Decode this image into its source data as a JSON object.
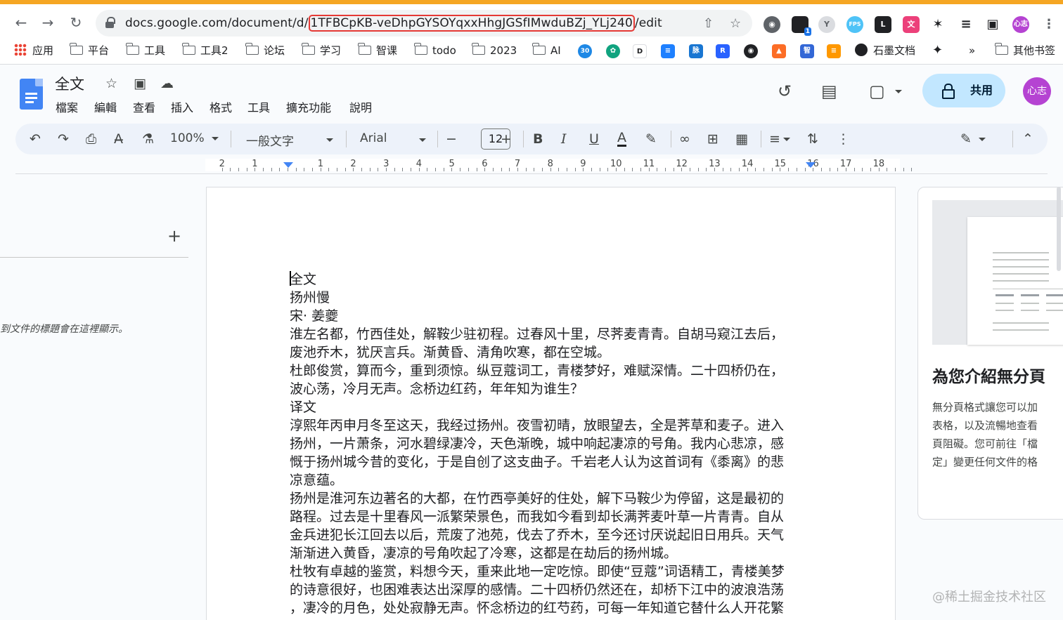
{
  "browser": {
    "url_prefix": "docs.google.com/document/d/",
    "url_id": "1TFBCpKB-veDhpGYSOYqxxHhgJGSfIMwduBZj_YLj240",
    "url_suffix": "/edit",
    "profile_avatar": "心志",
    "extension_badge": "1"
  },
  "bookmarks": {
    "apps": "应用",
    "folders": [
      "平台",
      "工具",
      "工具2",
      "论坛",
      "学习",
      "智课",
      "todo",
      "2023",
      "AI"
    ],
    "badge_30": "30",
    "shimo": "石墨文档",
    "more": "»",
    "other": "其他书签"
  },
  "docs": {
    "title": "全文",
    "menu": [
      "檔案",
      "編輯",
      "查看",
      "插入",
      "格式",
      "工具",
      "擴充功能",
      "說明"
    ],
    "share_label": "共用",
    "avatar": "心志"
  },
  "toolbar": {
    "zoom": "100%",
    "style": "一般文字",
    "font": "Arial",
    "font_size": "12",
    "minus": "−",
    "plus": "+",
    "bold": "B",
    "italic": "I",
    "underline": "U",
    "text_color": "A"
  },
  "ruler": {
    "labels": [
      "2",
      "1",
      "1",
      "2",
      "3",
      "4",
      "5",
      "6",
      "7",
      "8",
      "9",
      "10",
      "11",
      "12",
      "13",
      "14",
      "15",
      "16",
      "17",
      "18"
    ]
  },
  "outline": {
    "hint": "到文件的標題會在這裡顯示。",
    "add": "+"
  },
  "document": {
    "lines": [
      "全文",
      "扬州慢",
      "宋· 姜夔",
      "淮左名都，竹西佳处，解鞍少驻初程。过春风十里，尽荠麦青青。自胡马窥江去后，",
      "废池乔木，犹厌言兵。渐黄昏、清角吹寒，都在空城。",
      "杜郎俊赏，算而今，重到须惊。纵豆蔻词工，青楼梦好，难赋深情。二十四桥仍在，",
      "波心荡，冷月无声。念桥边红药，年年知为谁生？",
      "译文",
      "淳熙年丙申月冬至这天，我经过扬州。夜雪初晴，放眼望去，全是荠草和麦子。进入",
      "扬州，一片萧条，河水碧绿凄冷，天色渐晚，城中响起凄凉的号角。我内心悲凉，感",
      "慨于扬州城今昔的变化，于是自创了这支曲子。千岩老人认为这首词有《黍离》的悲",
      "凉意蕴。",
      "扬州是淮河东边著名的大都，在竹西亭美好的住处，解下马鞍少为停留，这是最初的",
      "路程。过去是十里春风一派繁荣景色，而我如今看到却长满荠麦叶草一片青青。自从",
      "金兵进犯长江回去以后，荒废了池苑，伐去了乔木，至今还讨厌说起旧日用兵。天气",
      "渐渐进入黄昏，凄凉的号角吹起了冷寒，这都是在劫后的扬州城。",
      "杜牧有卓越的鉴赏，料想今天，重来此地一定吃惊。即使“豆蔻”词语精工，青楼美梦",
      "的诗意很好，也困难表达出深厚的感情。二十四桥仍然还在，却桥下江中的波浪浩荡",
      "，凄冷的月色，处处寂静无声。怀念桥边的红芍药，可每一年知道它替什么人开花繁"
    ]
  },
  "side_panel": {
    "heading": "為您介紹無分頁",
    "body": [
      "無分頁格式讓您可以加",
      "表格，以及流暢地查看",
      "頁阻礙。您可前往「檔",
      "定」變更任何文件的格"
    ]
  },
  "watermark": "@稀土掘金技术社区",
  "colors": {
    "accent_orange": "#f5a623",
    "share_bg": "#c2e7ff",
    "docs_blue": "#4285f4",
    "url_highlight": "#e53935",
    "avatar": "#b543d2"
  }
}
